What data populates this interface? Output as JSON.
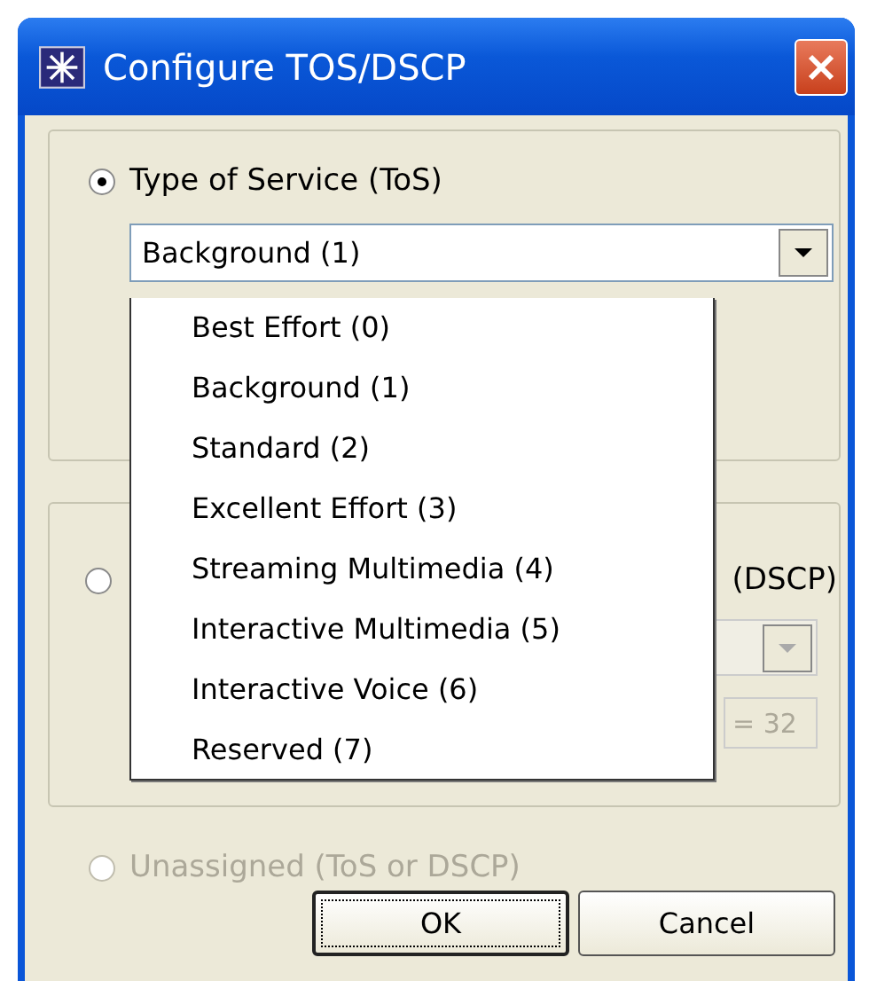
{
  "window": {
    "title": "Configure TOS/DSCP"
  },
  "tos": {
    "label": "Type of Service (ToS)",
    "selected": true,
    "combo": {
      "value": "Background (1)"
    },
    "dropdown": [
      {
        "label": "Best Effort (0)",
        "selected": false
      },
      {
        "label": "Background (1)",
        "selected": false
      },
      {
        "label": "Standard (2)",
        "selected": false
      },
      {
        "label": "Excellent Effort (3)",
        "selected": false
      },
      {
        "label": "Streaming Multimedia (4)",
        "selected": false
      },
      {
        "label": "Interactive Multimedia (5)",
        "selected": false
      },
      {
        "label": "Interactive Voice (6)",
        "selected": false
      },
      {
        "label": "Reserved (7)",
        "selected": false
      }
    ]
  },
  "dscp": {
    "label": "(DSCP)",
    "selected": false,
    "disabled_combo": true,
    "field": {
      "value": "= 32",
      "disabled": true
    }
  },
  "unassigned": {
    "label": "Unassigned (ToS or DSCP)",
    "selected": false,
    "disabled": true
  },
  "buttons": [
    {
      "label": "OK",
      "default": true
    },
    {
      "label": "Cancel",
      "default": false
    }
  ]
}
